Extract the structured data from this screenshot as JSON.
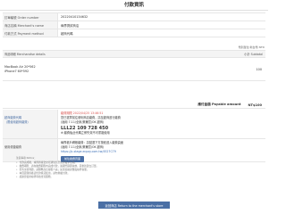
{
  "page": {
    "title": "付款資訊"
  },
  "order_info": [
    {
      "label": "訂單編號 Order number",
      "value": "20220410134632"
    },
    {
      "label": "商店名稱 Merchant's name",
      "value": "綠界測試商店"
    },
    {
      "label": "付款方式 Payment method",
      "value": "超商代碼"
    }
  ],
  "items": {
    "unit_note": "幣別單位:新台幣 NTD",
    "header_label": "商品明細 Merchandise details",
    "header_right": "小計 Subtotal",
    "name_line1": "MacBook Air 20*562",
    "name_line2": "iPhone7 60*592",
    "subtotal": "100"
  },
  "total": {
    "label": "應付金額 Payable amount",
    "value": "NT$100"
  },
  "payment": {
    "label": "超商繳費代碼",
    "label_sub": "（限使用超商繳費）",
    "deadline": "繳費期限 2022/04/25 13:46:51",
    "instruction1": "您已選擇前往便利商店繳費，請至超商進行繳費",
    "instruction2": "(適用 7-11/全家/萊爾富/OK 超商)",
    "code": "LLL22 109 728 450",
    "instruction3": "※ 繳費後此代碼立即失效不可重複使用",
    "app_label": "使用便捷繳費",
    "app_line1": "綠界帳戶轉帳繳費：請點選下方按鈕進入繳費頁面",
    "app_line2": "(適用 7-11/全家/萊爾富/OK 超商)",
    "app_link": "https://p-stage.ecpay.com.tw/4527C79",
    "app_button": "前往繳費頁面"
  },
  "notice": {
    "title": "注意事項 Notice：",
    "items": [
      "付款完成後，綠界將寄送交易通知信至您的電子信箱。",
      "繳費期限：請在繳費期限內完成付款，逾期代碼即失效，需重新建立訂單。",
      "若有交易問題，請聯繫商店客服人員；如需協助請致電綠界客服。",
      "本頁面僅供確認付款資訊使用，請勿重複付款。",
      "感謝您使用綠界科技金流服務。"
    ]
  },
  "return_button": "返回商店 Return to the merchant's store"
}
